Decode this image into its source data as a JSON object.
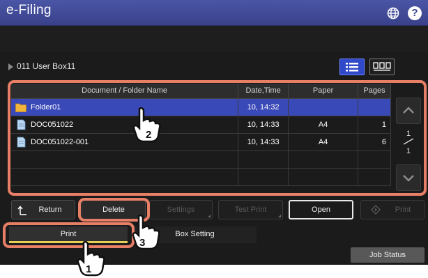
{
  "title": "e-Filing",
  "header": {
    "help_label": "?"
  },
  "box": {
    "name": "011 User Box11"
  },
  "table": {
    "columns": [
      "Document / Folder Name",
      "Date,Time",
      "Paper",
      "Pages"
    ],
    "rows": [
      {
        "type": "folder",
        "name": "Folder01",
        "date": "10, 14:32",
        "paper": "",
        "pages": "",
        "selected": true
      },
      {
        "type": "document",
        "name": "DOC051022",
        "date": "10, 14:33",
        "paper": "A4",
        "pages": "1",
        "selected": false
      },
      {
        "type": "document",
        "name": "DOC051022-001",
        "date": "10, 14:33",
        "paper": "A4",
        "pages": "6",
        "selected": false
      }
    ]
  },
  "pager": {
    "current": "1",
    "total": "1"
  },
  "buttons": {
    "return": "Return",
    "delete": "Delete",
    "settings": "Settings",
    "test_print": "Test Print",
    "open": "Open",
    "print": "Print"
  },
  "tabs": {
    "print": "Print",
    "box_setting": "Box Setting"
  },
  "footer": {
    "job_status": "Job Status"
  },
  "steps": [
    "1",
    "2",
    "3"
  ],
  "colors": {
    "title_bar": "#3b448e",
    "selection": "#3a49b8",
    "highlight": "#e77e66",
    "active_tab_underline": "#e7cf55"
  }
}
